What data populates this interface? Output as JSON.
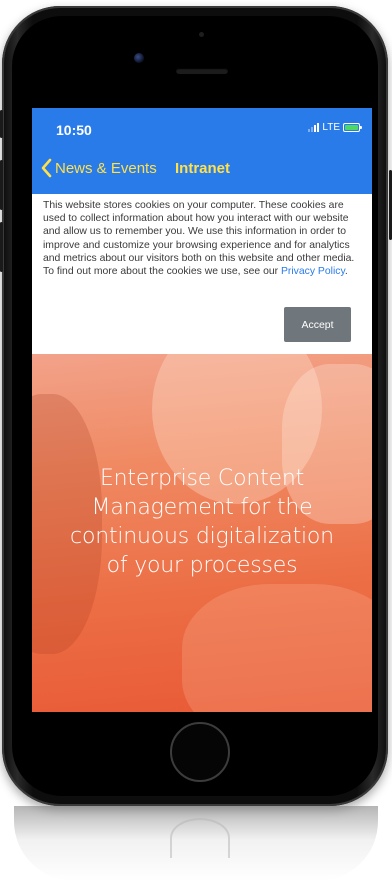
{
  "status_bar": {
    "time": "10:50",
    "network": "LTE"
  },
  "nav": {
    "back_label": "News & Events",
    "title": "Intranet"
  },
  "cookie_banner": {
    "text": "This website stores cookies on your computer. These cookies are used to collect information about how you interact with our website and allow us to remember you. We use this information in order to improve and customize your browsing experience and for analytics and metrics about our visitors both on this website and other media. To find out more about the cookies we use, see our ",
    "link_label": "Privacy Policy",
    "text_end": ".",
    "accept_label": "Accept"
  },
  "hero": {
    "line1": "Enterprise Content",
    "line2": "Management for the",
    "line3": "continuous digitalization",
    "line4": "of your processes"
  },
  "colors": {
    "header": "#2a7bea",
    "nav_accent": "#ffe14a",
    "accept_button": "#6f767c",
    "link": "#2a7bea",
    "hero_gradient_start": "#f2a28a",
    "hero_gradient_end": "#e85a35"
  },
  "icons": {
    "back": "chevron-left-icon",
    "signal": "signal-icon",
    "battery": "battery-icon"
  }
}
